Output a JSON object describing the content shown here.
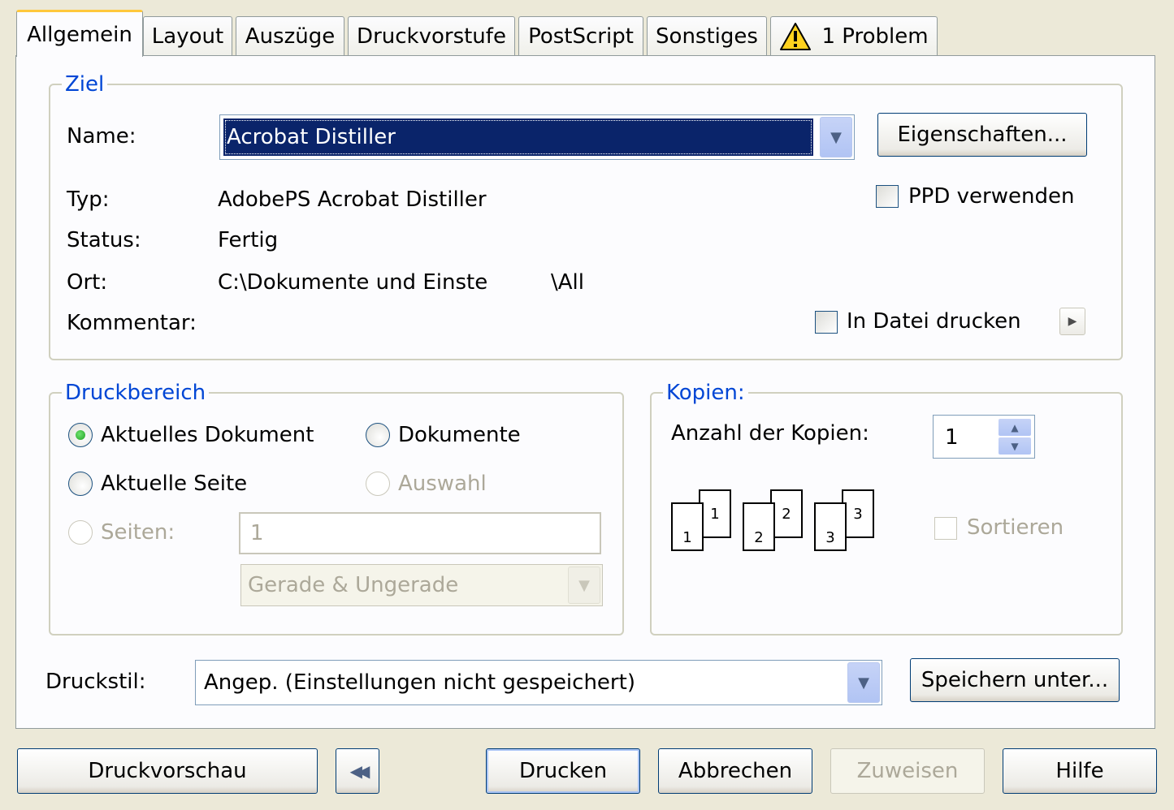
{
  "tabs": [
    {
      "label": "Allgemein",
      "active": true
    },
    {
      "label": "Layout"
    },
    {
      "label": "Auszüge"
    },
    {
      "label": "Druckvorstufe"
    },
    {
      "label": "PostScript"
    },
    {
      "label": "Sonstiges"
    },
    {
      "label": "1 Problem",
      "icon": "warning-icon"
    }
  ],
  "ziel": {
    "legend": "Ziel",
    "name_label": "Name:",
    "name_value": "Acrobat Distiller",
    "properties_button": "Eigenschaften...",
    "type_label": "Typ:",
    "type_value": "AdobePS Acrobat Distiller",
    "ppd_label": "PPD verwenden",
    "status_label": "Status:",
    "status_value": "Fertig",
    "location_label": "Ort:",
    "location_value": "C:\\Dokumente und Einste",
    "location_value_2": "\\All",
    "comment_label": "Kommentar:",
    "print_to_file_label": "In Datei drucken"
  },
  "druckbereich": {
    "legend": "Druckbereich",
    "current_document": "Aktuelles Dokument",
    "documents": "Dokumente",
    "current_page": "Aktuelle Seite",
    "selection": "Auswahl",
    "pages_label": "Seiten:",
    "pages_value": "1",
    "parity_value": "Gerade & Ungerade"
  },
  "kopien": {
    "legend": "Kopien:",
    "count_label": "Anzahl der Kopien:",
    "count_value": "1",
    "page_numbers": [
      "1",
      "2",
      "3"
    ],
    "collate_label": "Sortieren"
  },
  "druckstil": {
    "label": "Druckstil:",
    "value": "Angep. (Einstellungen nicht gespeichert)",
    "save_button": "Speichern unter..."
  },
  "footer": {
    "preview_button": "Druckvorschau",
    "print_button": "Drucken",
    "cancel_button": "Abbrechen",
    "assign_button": "Zuweisen",
    "help_button": "Hilfe"
  },
  "colors": {
    "dialog_bg": "#ece9d8",
    "legend_blue": "#0046d5",
    "selection_blue": "#0a246a",
    "active_tab_accent": "#ffc83c"
  }
}
